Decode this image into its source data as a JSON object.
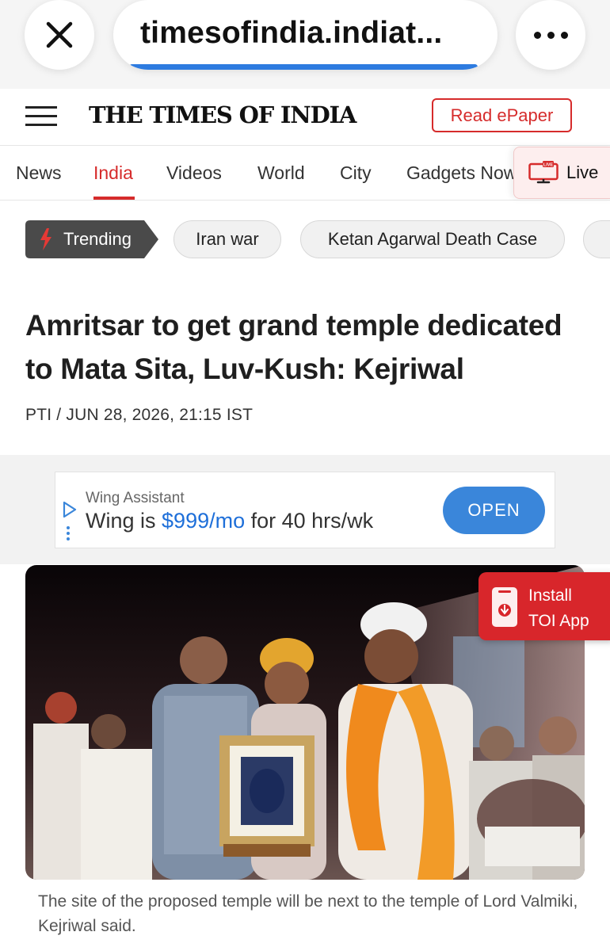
{
  "browser": {
    "url": "timesofindia.indiat...",
    "icons": {
      "close": "close-icon",
      "more": "more-icon"
    }
  },
  "masthead": {
    "logo": "THE TIMES OF INDIA",
    "read_epaper": "Read ePaper",
    "icons": {
      "menu": "hamburger-icon"
    }
  },
  "nav": {
    "tabs": [
      "News",
      "India",
      "Videos",
      "World",
      "City",
      "Gadgets Now"
    ],
    "active": "India",
    "live_label": "Live",
    "live_icon": "live-tv-icon"
  },
  "trending": {
    "badge": "Trending",
    "badge_icon": "flame-icon",
    "chips": [
      "Iran war",
      "Ketan Agarwal Death Case"
    ]
  },
  "article": {
    "headline": "Amritsar to get grand temple dedicated to Mata Sita, Luv-Kush: Kejriwal",
    "byline": "PTI / JUN 28, 2026, 21:15 IST",
    "caption": "The site of the proposed temple will be next to the temple of Lord Valmiki, Kejriwal said."
  },
  "ad": {
    "sponsor": "Wing Assistant",
    "text_before": "Wing is ",
    "price": "$999/mo",
    "text_after": " for 40 hrs/wk",
    "cta": "OPEN"
  },
  "install": {
    "line1": "Install",
    "line2": "TOI App"
  },
  "colors": {
    "brand_red": "#d62b2b",
    "link_blue": "#1e6fd9",
    "ad_button": "#3a86da",
    "browser_progress": "#2d7be0"
  }
}
